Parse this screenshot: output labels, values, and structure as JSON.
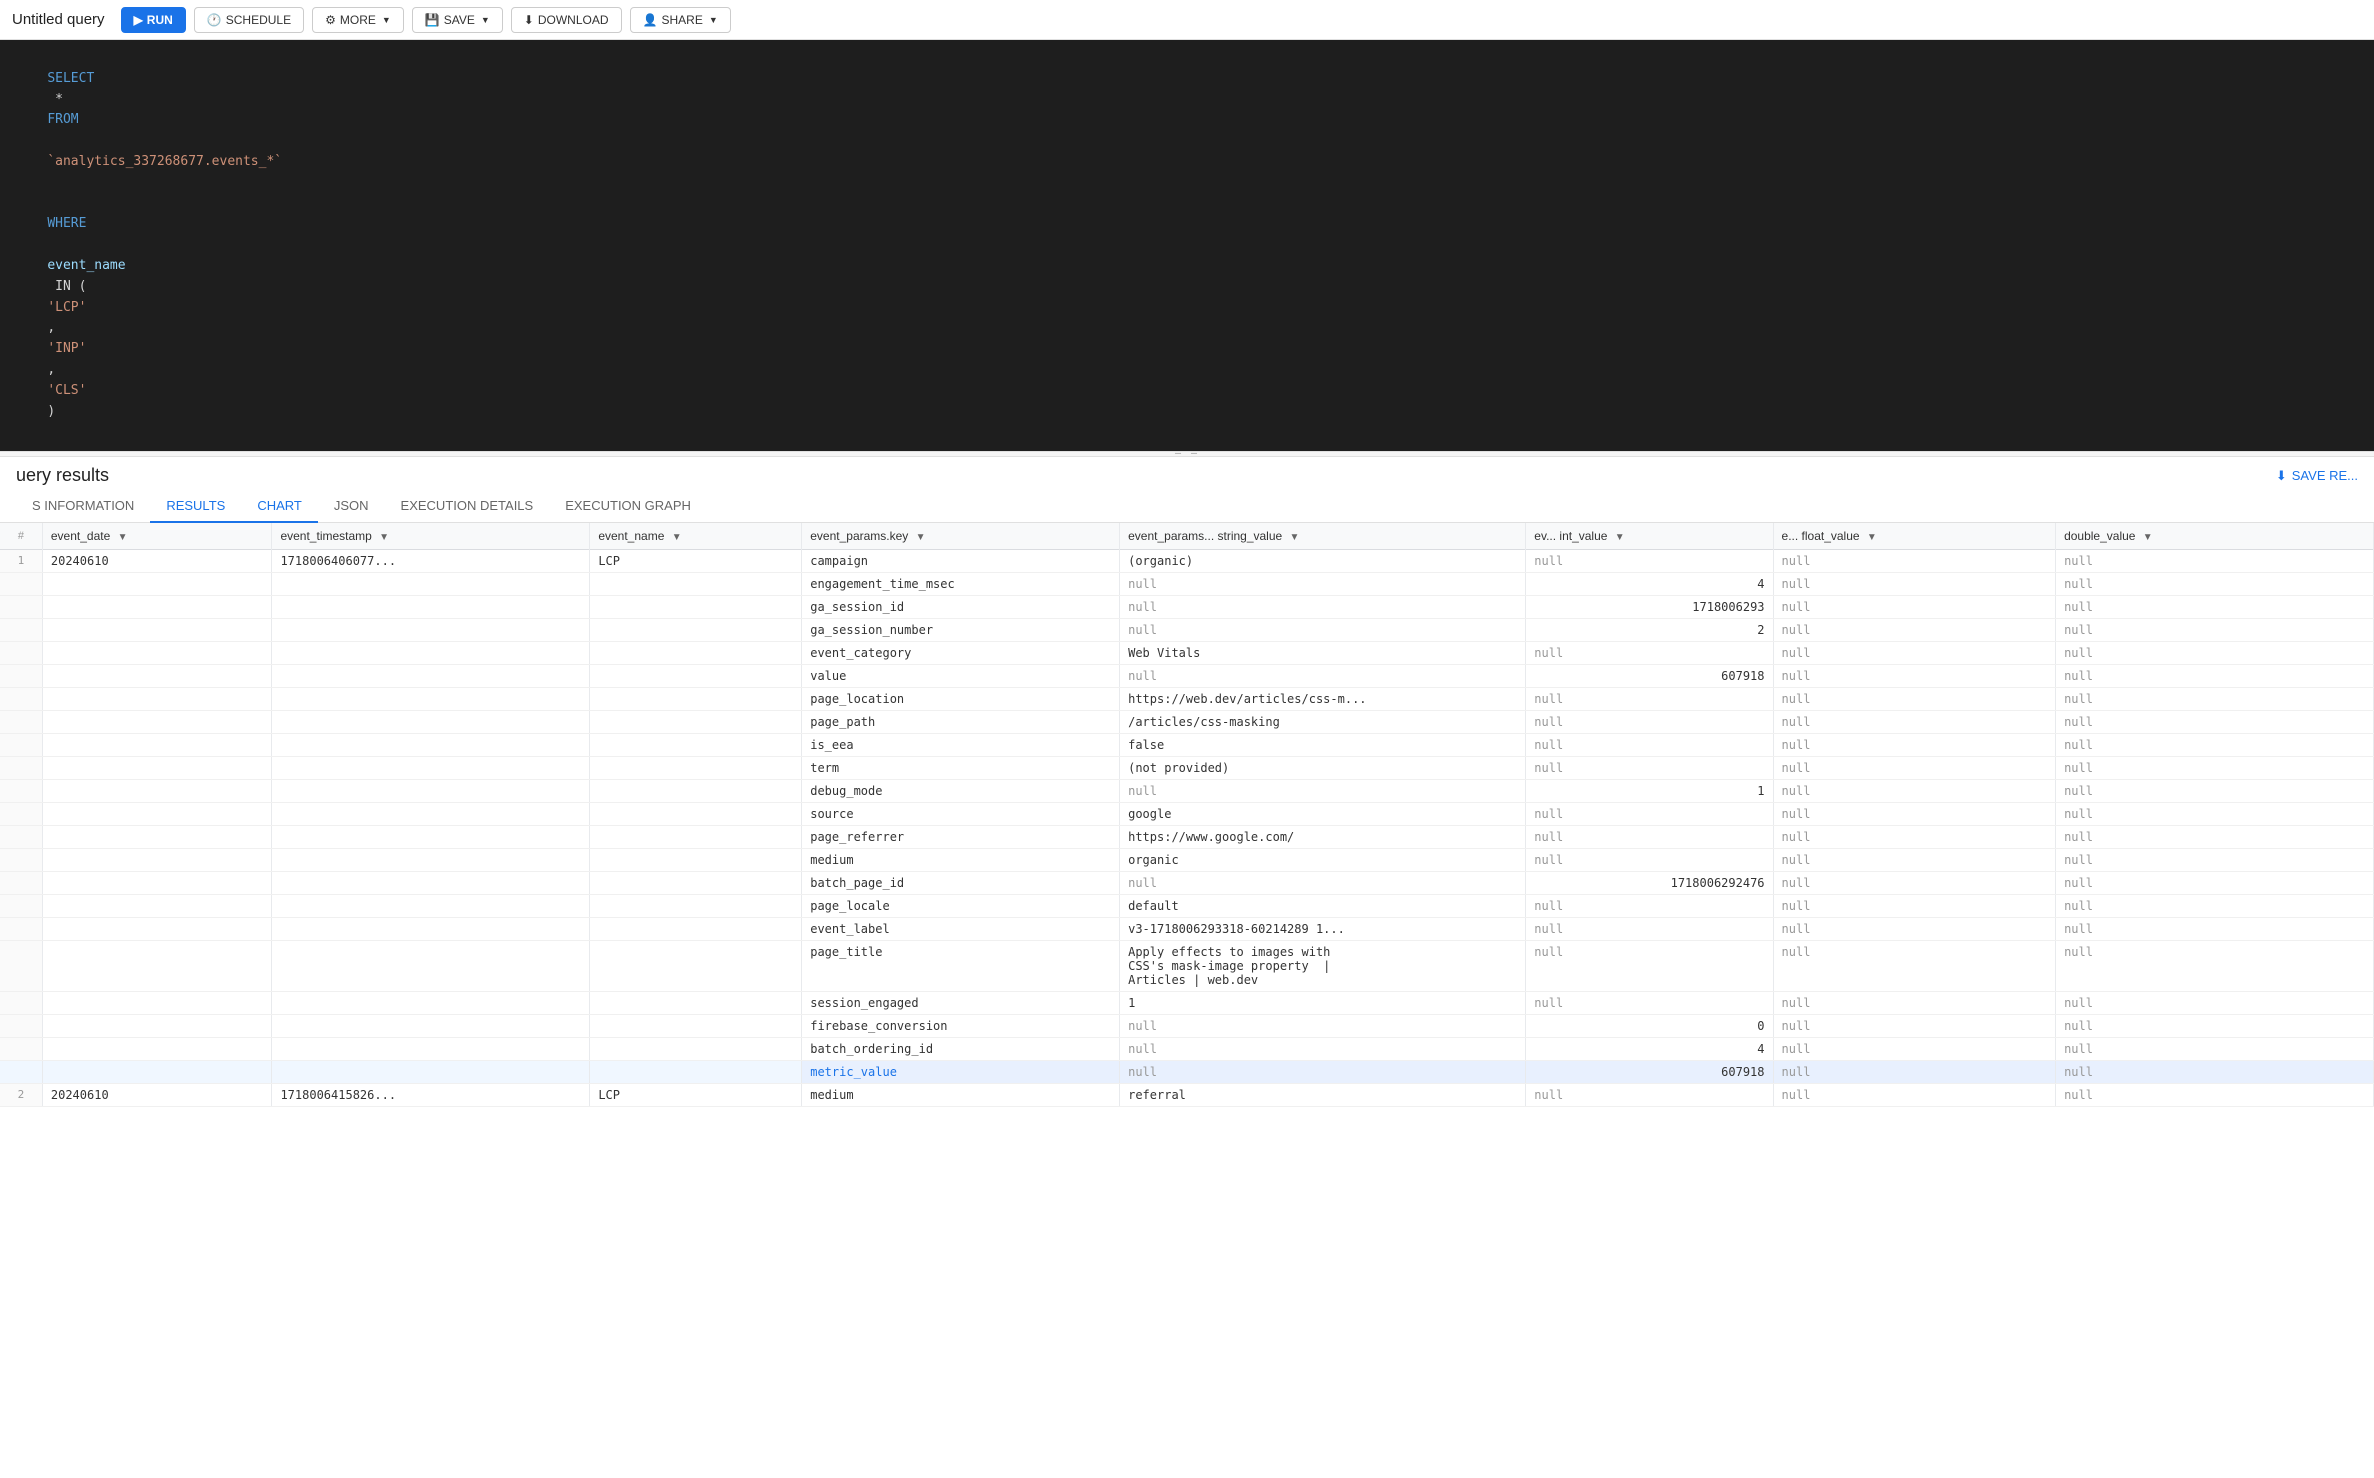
{
  "app": {
    "title": "Untitled query"
  },
  "toolbar": {
    "run_label": "RUN",
    "schedule_label": "SCHEDULE",
    "more_label": "MORE",
    "save_label": "SAVE",
    "download_label": "DOWNLOAD",
    "share_label": "SHARE"
  },
  "sql": {
    "line1": "SELECT * FROM `analytics_337268677.events_*`",
    "line2": "WHERE event_name IN ('LCP', 'INP', 'CLS')"
  },
  "results": {
    "title": "uery results",
    "save_btn": "SAVE RE..."
  },
  "tabs": [
    {
      "id": "schema",
      "label": "S INFORMATION"
    },
    {
      "id": "results",
      "label": "RESULTS",
      "active": true
    },
    {
      "id": "chart",
      "label": "CHART"
    },
    {
      "id": "json",
      "label": "JSON"
    },
    {
      "id": "execution_details",
      "label": "EXECUTION DETAILS"
    },
    {
      "id": "execution_graph",
      "label": "EXECUTION GRAPH"
    }
  ],
  "columns": [
    {
      "id": "event_date",
      "label": "event_date",
      "sort": true
    },
    {
      "id": "event_timestamp",
      "label": "event_timestamp",
      "sort": true
    },
    {
      "id": "event_name",
      "label": "event_name",
      "sort": true
    },
    {
      "id": "params_key",
      "label": "event_params.key",
      "sort": true
    },
    {
      "id": "params_str",
      "label": "event_params... string_value",
      "sort": true
    },
    {
      "id": "int_value",
      "label": "ev... int_value",
      "sort": true
    },
    {
      "id": "float_value",
      "label": "e... float_value",
      "sort": true
    },
    {
      "id": "double_value",
      "label": "double_value",
      "sort": true
    }
  ],
  "rows": [
    {
      "row_num": "1",
      "event_date": "20240610",
      "event_timestamp": "1718006406077...",
      "event_name": "LCP",
      "params": [
        {
          "key": "campaign",
          "str": "(organic)",
          "int": "null",
          "float": "null",
          "double": "null",
          "int_class": "null-val",
          "float_class": "null-val",
          "double_class": "null-val"
        },
        {
          "key": "engagement_time_msec",
          "str": "null",
          "int": "4",
          "float": "null",
          "double": "null",
          "str_class": "null-val",
          "float_class": "null-val",
          "double_class": "null-val",
          "int_class": "number-val"
        },
        {
          "key": "ga_session_id",
          "str": "null",
          "int": "1718006293",
          "float": "null",
          "double": "null",
          "str_class": "null-val",
          "float_class": "null-val",
          "double_class": "null-val",
          "int_class": "number-val"
        },
        {
          "key": "ga_session_number",
          "str": "null",
          "int": "2",
          "float": "null",
          "double": "null",
          "str_class": "null-val",
          "float_class": "null-val",
          "double_class": "null-val",
          "int_class": "number-val"
        },
        {
          "key": "event_category",
          "str": "Web Vitals",
          "int": "null",
          "float": "null",
          "double": "null",
          "int_class": "null-val",
          "float_class": "null-val",
          "double_class": "null-val"
        },
        {
          "key": "value",
          "str": "null",
          "int": "607918",
          "float": "null",
          "double": "null",
          "str_class": "null-val",
          "float_class": "null-val",
          "double_class": "null-val",
          "int_class": "number-val"
        },
        {
          "key": "page_location",
          "str": "https://web.dev/articles/css-m...",
          "int": "null",
          "float": "null",
          "double": "null",
          "int_class": "null-val",
          "float_class": "null-val",
          "double_class": "null-val"
        },
        {
          "key": "page_path",
          "str": "/articles/css-masking",
          "int": "null",
          "float": "null",
          "double": "null",
          "int_class": "null-val",
          "float_class": "null-val",
          "double_class": "null-val"
        },
        {
          "key": "is_eea",
          "str": "false",
          "int": "null",
          "float": "null",
          "double": "null",
          "int_class": "null-val",
          "float_class": "null-val",
          "double_class": "null-val"
        },
        {
          "key": "term",
          "str": "(not provided)",
          "int": "null",
          "float": "null",
          "double": "null",
          "int_class": "null-val",
          "float_class": "null-val",
          "double_class": "null-val"
        },
        {
          "key": "debug_mode",
          "str": "null",
          "int": "1",
          "float": "null",
          "double": "null",
          "str_class": "null-val",
          "float_class": "null-val",
          "double_class": "null-val",
          "int_class": "number-val"
        },
        {
          "key": "source",
          "str": "google",
          "int": "null",
          "float": "null",
          "double": "null",
          "int_class": "null-val",
          "float_class": "null-val",
          "double_class": "null-val"
        },
        {
          "key": "page_referrer",
          "str": "https://www.google.com/",
          "int": "null",
          "float": "null",
          "double": "null",
          "int_class": "null-val",
          "float_class": "null-val",
          "double_class": "null-val"
        },
        {
          "key": "medium",
          "str": "organic",
          "int": "null",
          "float": "null",
          "double": "null",
          "int_class": "null-val",
          "float_class": "null-val",
          "double_class": "null-val"
        },
        {
          "key": "batch_page_id",
          "str": "null",
          "int": "1718006292476",
          "float": "null",
          "double": "null",
          "str_class": "null-val",
          "float_class": "null-val",
          "double_class": "null-val",
          "int_class": "number-val"
        },
        {
          "key": "page_locale",
          "str": "default",
          "int": "null",
          "float": "null",
          "double": "null",
          "int_class": "null-val",
          "float_class": "null-val",
          "double_class": "null-val"
        },
        {
          "key": "event_label",
          "str": "v3-1718006293318-60214289 1...",
          "int": "null",
          "float": "null",
          "double": "null",
          "int_class": "null-val",
          "float_class": "null-val",
          "double_class": "null-val"
        },
        {
          "key": "page_title",
          "str": "Apply effects to images with\nCSS's mask-image property  |\nArticles | web.dev",
          "int": "null",
          "float": "null",
          "double": "null",
          "int_class": "null-val",
          "float_class": "null-val",
          "double_class": "null-val",
          "multiline": true
        },
        {
          "key": "session_engaged",
          "str": "1",
          "int": "null",
          "float": "null",
          "double": "null",
          "int_class": "null-val",
          "float_class": "null-val",
          "double_class": "null-val"
        },
        {
          "key": "firebase_conversion",
          "str": "null",
          "int": "0",
          "float": "null",
          "double": "null",
          "str_class": "null-val",
          "float_class": "null-val",
          "double_class": "null-val",
          "int_class": "number-val"
        },
        {
          "key": "batch_ordering_id",
          "str": "null",
          "int": "4",
          "float": "null",
          "double": "null",
          "str_class": "null-val",
          "float_class": "null-val",
          "double_class": "null-val",
          "int_class": "number-val"
        },
        {
          "key": "metric_value",
          "str": "null",
          "int": "607918",
          "float": "null",
          "double": "null",
          "str_class": "null-highlight",
          "highlight": true,
          "int_highlight": true,
          "float_class": "null-highlight",
          "double_class": "null-highlight",
          "key_highlight": true
        }
      ]
    },
    {
      "row_num": "2",
      "event_date": "20240610",
      "event_timestamp": "1718006415826...",
      "event_name": "LCP",
      "params": [
        {
          "key": "medium",
          "str": "referral",
          "int": "null",
          "float": "null",
          "double": "null",
          "int_class": "null-val",
          "float_class": "null-val",
          "double_class": "null-val"
        }
      ]
    }
  ]
}
